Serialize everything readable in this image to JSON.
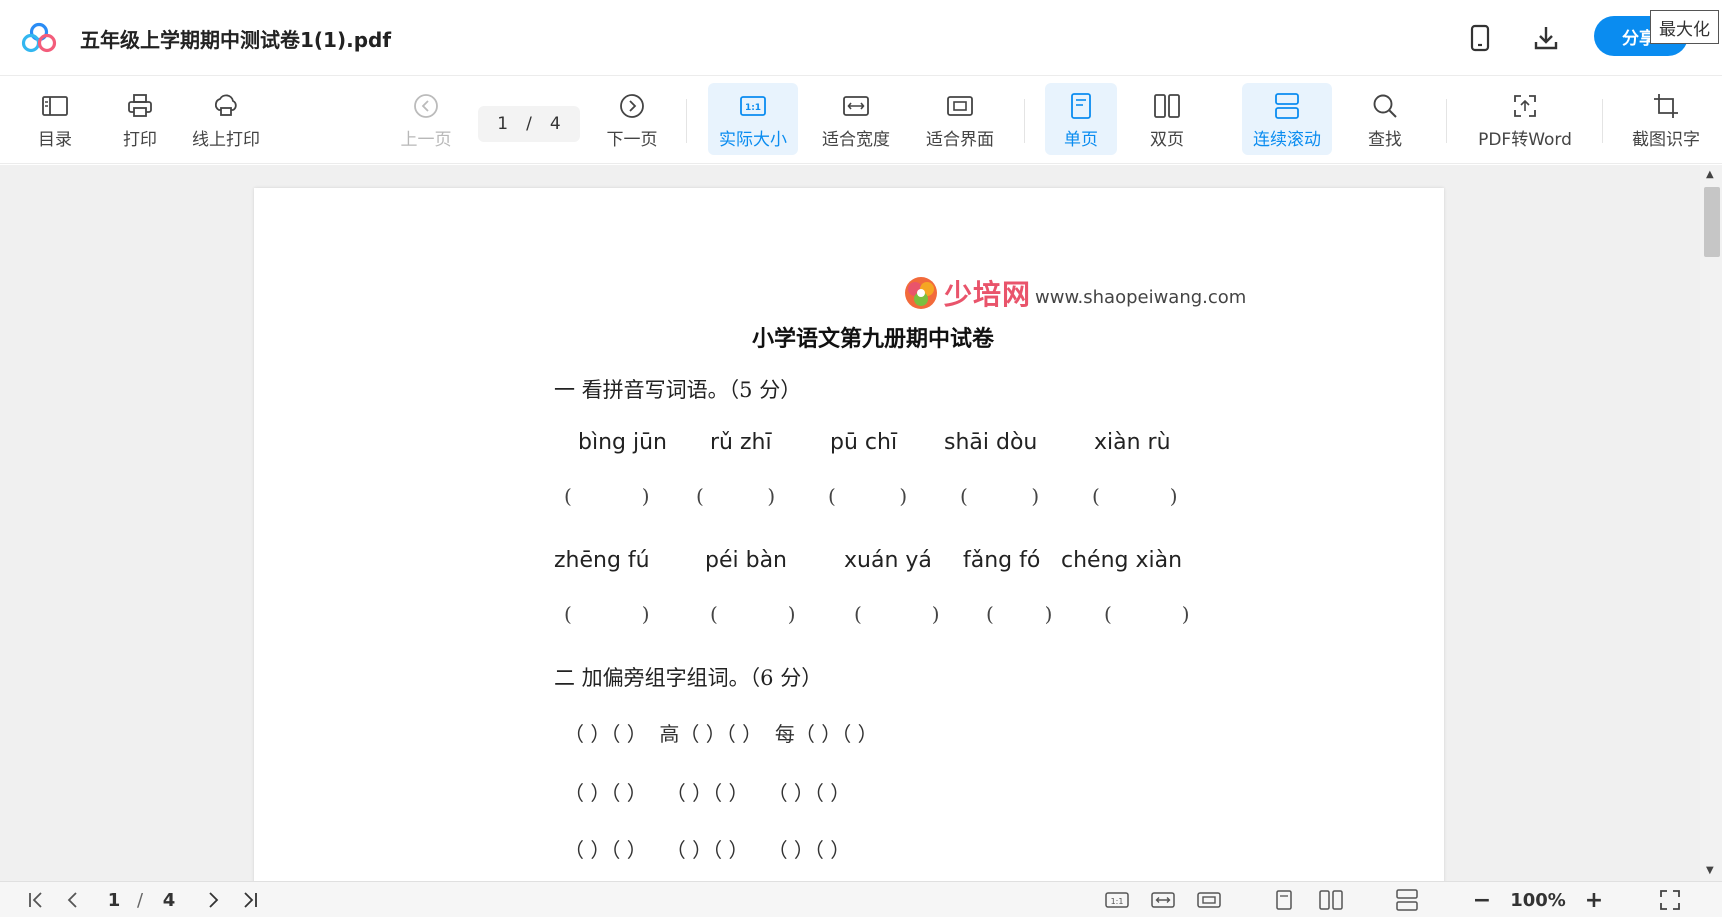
{
  "titlebar": {
    "doc_title": "五年级上学期期中测试卷1(1).pdf",
    "share_label": "分享",
    "tooltip": "最大化",
    "icons": [
      "app-logo",
      "phone-icon",
      "download-icon"
    ]
  },
  "toolbar": {
    "toc": "目录",
    "print": "打印",
    "online_print": "线上打印",
    "prev_page": "上一页",
    "current_page": "1",
    "page_sep": "/",
    "total_pages": "4",
    "next_page": "下一页",
    "actual_size": "实际大小",
    "fit_width": "适合宽度",
    "fit_screen": "适合界面",
    "single_page": "单页",
    "double_page": "双页",
    "continuous_scroll": "连续滚动",
    "find": "查找",
    "pdf_to_word": "PDF转Word",
    "screenshot_ocr": "截图识字",
    "accent_color": "#0a8cf0"
  },
  "document": {
    "site_brand": "少培网",
    "site_url": "www.shaopeiwang.com",
    "exam_title": "小学语文第九册期中试卷",
    "section1_heading": "一  看拼音写词语。（5 分）",
    "pinyin_row1": [
      "bìng jūn",
      "rǔ zhī",
      "pū chī",
      "shāi dòu",
      "xiàn rù"
    ],
    "pinyin_row2": [
      "zhēng fú",
      "péi bàn",
      "xuán yá",
      "fǎng fó",
      "chéng xiàn"
    ],
    "section2_heading": "二  加偏旁组字组词。（6 分）",
    "section2_line1": "（ ）（ ）  高（ ）（ ）  每（ ）（ ）",
    "section2_line2": "（ ）（ ）   （ ）（ ）   （ ）（ ）",
    "section2_line3": "（ ）（ ）   （ ）（ ）   （ ）（ ）"
  },
  "statusbar": {
    "current_page": "1",
    "page_sep": "/",
    "total_pages": "4",
    "zoom": "100%"
  }
}
